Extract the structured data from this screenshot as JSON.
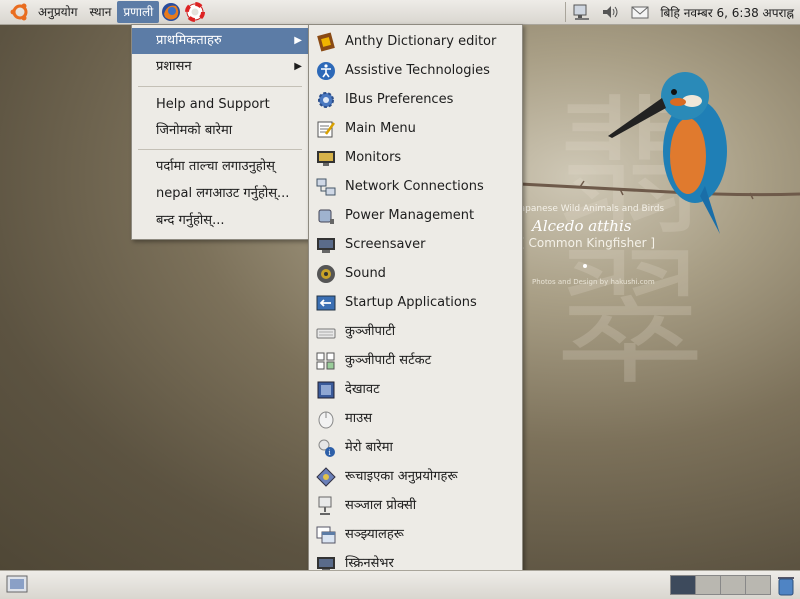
{
  "top_panel": {
    "applications_label": "अनुप्रयोग",
    "places_label": "स्थान",
    "system_label": "प्रणाली",
    "clock_text": "बिहि नवम्बर  6,  6:38 अपराह्न"
  },
  "system_menu": {
    "items": [
      {
        "label": "प्राथमिकताहरु",
        "submenu": true,
        "selected": true
      },
      {
        "label": "प्रशासन",
        "submenu": true
      },
      {
        "label": "Help and Support"
      },
      {
        "label": "जिनोमको बारेमा"
      },
      {
        "label": "पर्दामा ताल्चा लगाउनुहोस्"
      },
      {
        "label": "nepal लगआउट गर्नुहोस्..."
      },
      {
        "label": "बन्द गर्नुहोस्..."
      }
    ]
  },
  "preferences_menu": {
    "items": [
      {
        "label": "Anthy Dictionary editor",
        "icon": "dictionary-book-icon"
      },
      {
        "label": "Assistive Technologies",
        "icon": "accessibility-icon"
      },
      {
        "label": "IBus Preferences",
        "icon": "gear-icon"
      },
      {
        "label": "Main Menu",
        "icon": "menu-editor-icon"
      },
      {
        "label": "Monitors",
        "icon": "monitor-icon"
      },
      {
        "label": "Network Connections",
        "icon": "network-icon"
      },
      {
        "label": "Power Management",
        "icon": "power-icon"
      },
      {
        "label": "Screensaver",
        "icon": "screensaver-icon"
      },
      {
        "label": "Sound",
        "icon": "sound-icon"
      },
      {
        "label": "Startup Applications",
        "icon": "startup-icon"
      },
      {
        "label": "कुञ्जीपाटी",
        "icon": "keyboard-icon"
      },
      {
        "label": "कुञ्जीपाटी सर्टकट",
        "icon": "keyboard-shortcuts-icon"
      },
      {
        "label": "देखावट",
        "icon": "appearance-icon"
      },
      {
        "label": "माउस",
        "icon": "mouse-icon"
      },
      {
        "label": "मेरो बारेमा",
        "icon": "about-me-icon"
      },
      {
        "label": "रूचाइएका अनुप्रयोगहरू",
        "icon": "preferred-apps-icon"
      },
      {
        "label": "सञ्जाल प्रोक्सी",
        "icon": "network-proxy-icon"
      },
      {
        "label": "सञ्झ्यालहरू",
        "icon": "windows-icon"
      },
      {
        "label": "स्क्रिनसेभर",
        "icon": "screensaver-icon"
      }
    ]
  },
  "wallpaper": {
    "caption_top": "Japanese Wild Animals and Birds",
    "caption_species": "Alcedo atthis",
    "caption_common": "[ Common Kingfisher ]",
    "caption_credit": "Photos and Design by hakushi.com",
    "kanji": "翡翠"
  },
  "colors": {
    "selection": "#5c7ca6",
    "menu_bg": "#edebe6",
    "panel_bg": "#e4e2dc"
  }
}
